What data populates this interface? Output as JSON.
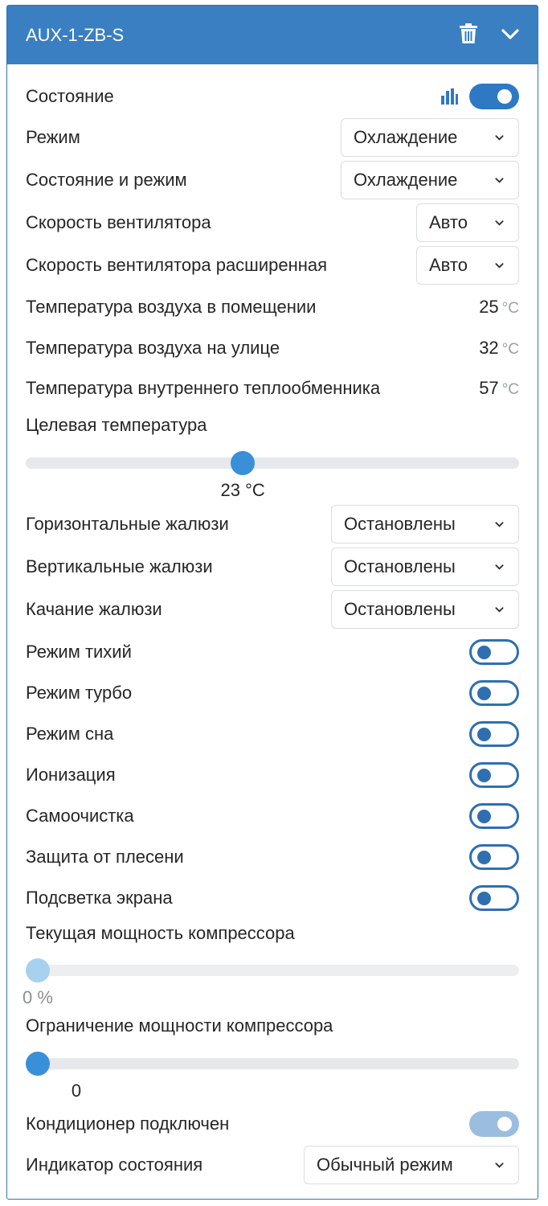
{
  "header": {
    "title": "AUX-1-ZB-S"
  },
  "state": {
    "label": "Состояние"
  },
  "mode": {
    "label": "Режим",
    "value": "Охлаждение"
  },
  "state_mode": {
    "label": "Состояние и режим",
    "value": "Охлаждение"
  },
  "fan_speed": {
    "label": "Скорость вентилятора",
    "value": "Авто"
  },
  "fan_speed_ext": {
    "label": "Скорость вентилятора расширенная",
    "value": "Авто"
  },
  "indoor_temp": {
    "label": "Температура воздуха в помещении",
    "value": "25",
    "unit": "°C"
  },
  "outdoor_temp": {
    "label": "Температура воздуха на улице",
    "value": "32",
    "unit": "°C"
  },
  "coil_temp": {
    "label": "Температура внутреннего теплообменника",
    "value": "57",
    "unit": "°C"
  },
  "target_temp": {
    "label": "Целевая температура",
    "value_label": "23 °C",
    "fraction": 0.44
  },
  "h_louvers": {
    "label": "Горизонтальные жалюзи",
    "value": "Остановлены"
  },
  "v_louvers": {
    "label": "Вертикальные жалюзи",
    "value": "Остановлены"
  },
  "swing": {
    "label": "Качание жалюзи",
    "value": "Остановлены"
  },
  "toggles": [
    {
      "label": "Режим тихий",
      "state": "off"
    },
    {
      "label": "Режим турбо",
      "state": "off"
    },
    {
      "label": "Режим сна",
      "state": "off"
    },
    {
      "label": "Ионизация",
      "state": "off"
    },
    {
      "label": "Самоочистка",
      "state": "off"
    },
    {
      "label": "Защита от плесени",
      "state": "off"
    },
    {
      "label": "Подсветка экрана",
      "state": "off"
    }
  ],
  "compressor_power": {
    "label": "Текущая мощность компрессора",
    "value_label": "0 %",
    "fraction": 0
  },
  "compressor_limit": {
    "label": "Ограничение мощности компрессора",
    "value_label": "0",
    "fraction": 0
  },
  "connected": {
    "label": "Кондиционер подключен",
    "state": "on"
  },
  "indicator": {
    "label": "Индикатор состояния",
    "value": "Обычный режим"
  },
  "colors": {
    "accent": "#3a7fc1",
    "slider_thumb": "#3a8fd9",
    "slider_thumb_disabled": "#a8d0ef"
  }
}
